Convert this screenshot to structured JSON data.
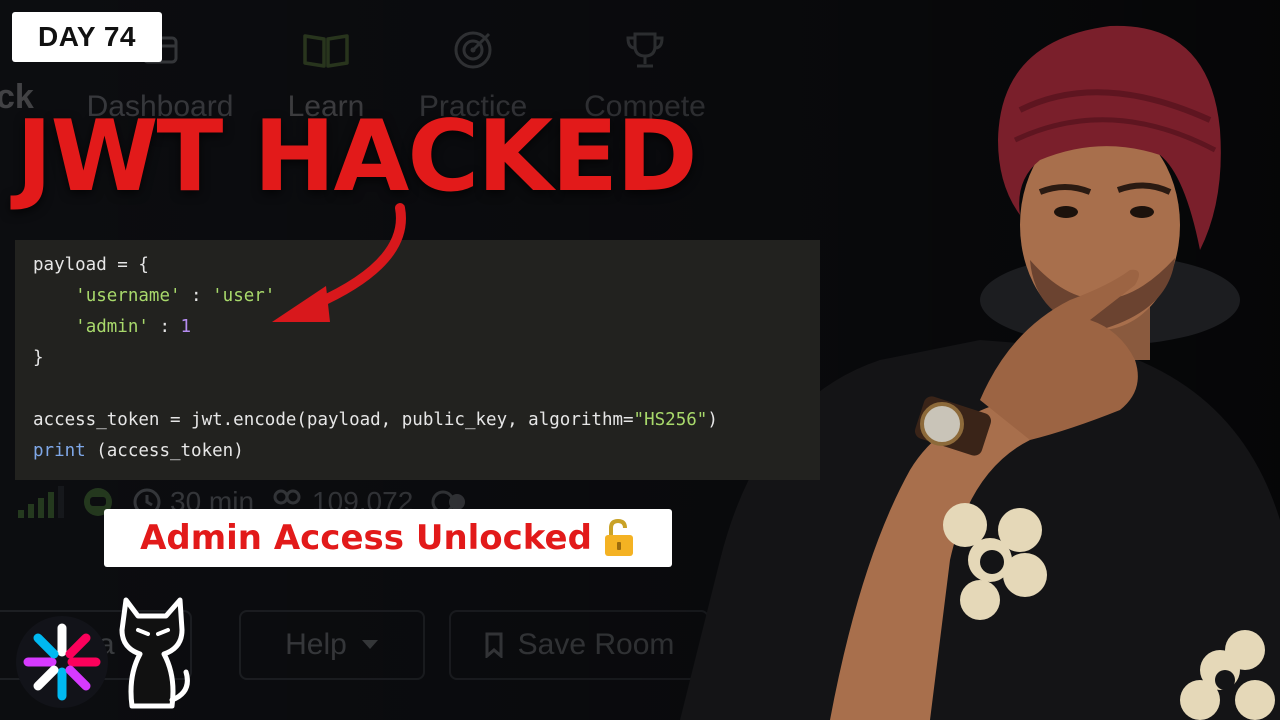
{
  "badge": {
    "day_label": "DAY 74"
  },
  "headline": "JWT HACKED",
  "background_ui": {
    "nav": [
      {
        "label": "Dashboard",
        "icon": "dashboard-icon"
      },
      {
        "label": "Learn",
        "icon": "book-icon"
      },
      {
        "label": "Practice",
        "icon": "target-icon"
      },
      {
        "label": "Compete",
        "icon": "trophy-icon"
      }
    ],
    "logo_fragment": "ck",
    "stats": {
      "duration": "30 min",
      "users": "109,072"
    },
    "buttons": {
      "partial_left": "Sta",
      "help": "Help",
      "save_room": "Save Room"
    }
  },
  "code": {
    "line1": "payload = {",
    "line2_key": "'username'",
    "line2_sep": " : ",
    "line2_val": "'user'",
    "line3_key": "'admin'",
    "line3_sep": " : ",
    "line3_val": "1",
    "line4": "}",
    "line6_prefix": "access_token = jwt.encode(payload, public_key, algorithm=",
    "line6_str": "\"HS256\"",
    "line6_suffix": ")",
    "line7_kw": "print",
    "line7_rest": " (access_token)"
  },
  "caption": {
    "text": "Admin Access Unlocked",
    "icon": "unlocked-padlock-icon"
  },
  "colors": {
    "accent_red": "#e21a1a",
    "code_bg": "#22221f",
    "string_green": "#a8d96b",
    "number_purple": "#b58cf0",
    "keyword_blue": "#7fa8e8",
    "background": "#0c0d10"
  }
}
